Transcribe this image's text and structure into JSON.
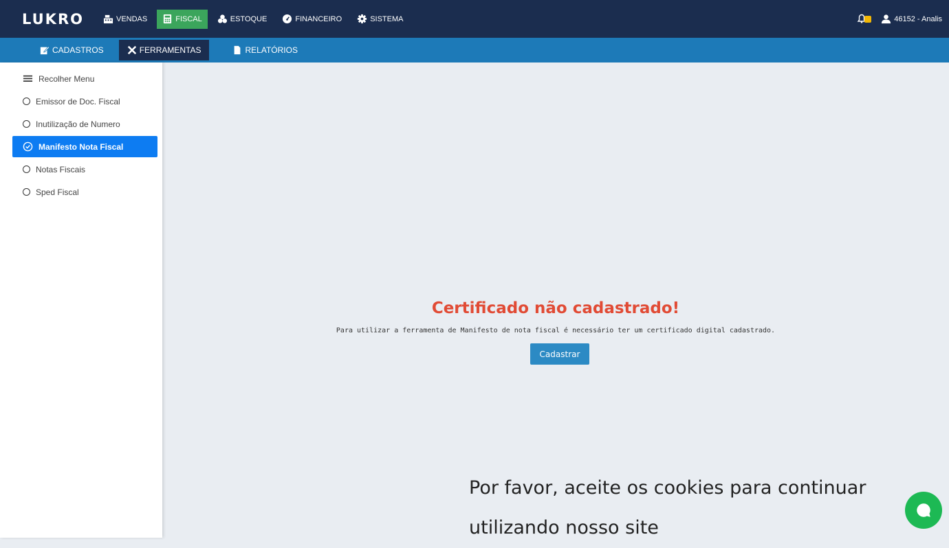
{
  "app": {
    "logo": "LUKRO"
  },
  "topnav": [
    {
      "label": "VENDAS",
      "icon": "cash-register-icon"
    },
    {
      "label": "FISCAL",
      "icon": "calculator-icon",
      "active": true
    },
    {
      "label": "ESTOQUE",
      "icon": "boxes-icon"
    },
    {
      "label": "FINANCEIRO",
      "icon": "dashboard-icon"
    },
    {
      "label": "SISTEMA",
      "icon": "gear-icon"
    }
  ],
  "user": {
    "label": "46152 - Analis"
  },
  "subnav": [
    {
      "label": "CADASTROS",
      "icon": "edit-icon"
    },
    {
      "label": "FERRAMENTAS",
      "icon": "tools-icon",
      "active": true
    },
    {
      "label": "RELATÓRIOS",
      "icon": "file-icon"
    }
  ],
  "sidebar": {
    "collapse_label": "Recolher Menu",
    "items": [
      {
        "label": "Emissor de Doc. Fiscal"
      },
      {
        "label": "Inutilização de Numero"
      },
      {
        "label": "Manifesto Nota Fiscal",
        "active": true
      },
      {
        "label": "Notas Fiscais"
      },
      {
        "label": "Sped Fiscal"
      }
    ]
  },
  "main": {
    "title": "Certificado não cadastrado!",
    "text": "Para utilizar a ferramenta de Manifesto de nota fiscal é necessário ter um certificado digital cadastrado.",
    "button": "Cadastrar"
  },
  "cookie": {
    "line1": "Por favor, aceite os cookies para continuar",
    "line2": "utilizando nosso site"
  },
  "colors": {
    "topbar": "#1b2d4f",
    "subbar": "#1d7ab8",
    "active_top": "#3ba55c",
    "active_side": "#0d7cf2",
    "title": "#e14b35",
    "chat": "#1db954"
  }
}
